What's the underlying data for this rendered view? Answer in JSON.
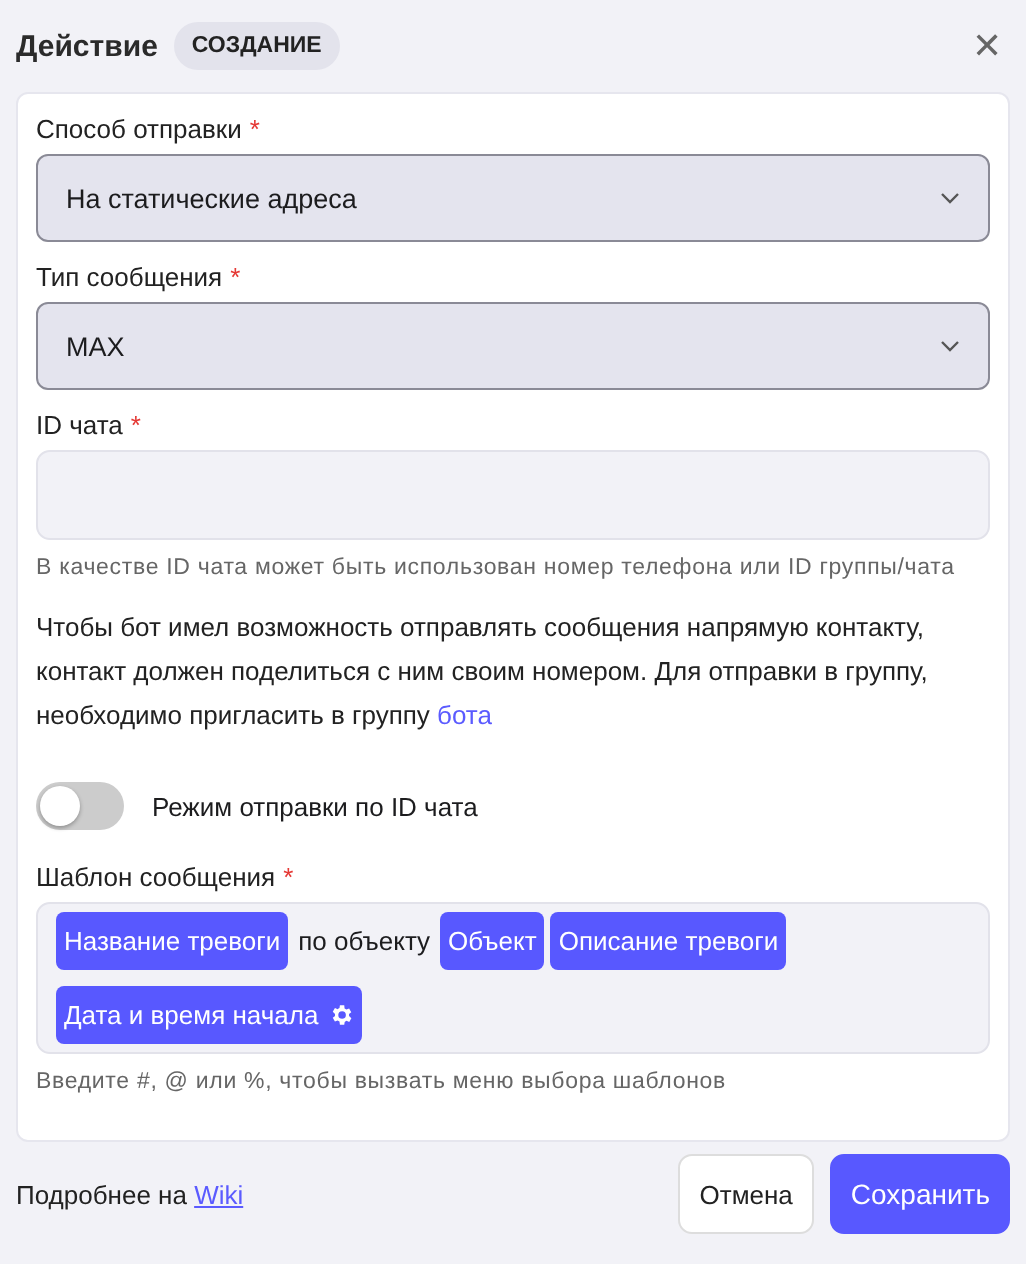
{
  "header": {
    "title": "Действие",
    "badge": "СОЗДАНИЕ",
    "close": "✕"
  },
  "fields": [
    {
      "kind": "select",
      "label": "Способ отправки",
      "required_mark": "*",
      "value": "На статические адреса"
    },
    {
      "kind": "select",
      "label": "Тип сообщения",
      "required_mark": "*",
      "value": "MAX"
    },
    {
      "kind": "input",
      "label": "ID чата",
      "required_mark": "*",
      "hint": "В качестве ID чата может быть использован номер телефона или ID группы/чата"
    }
  ],
  "info": {
    "text": "Чтобы бот имел возможность отправлять сообщения напрямую контакту, контакт должен поделиться с ним своим номером. Для отправки в группу, необходимо пригласить в группу ",
    "link": "бота"
  },
  "toggle": {
    "label": "Режим отправки по ID чата",
    "on": false
  },
  "template": {
    "label": "Шаблон сообщения",
    "required_mark": "*",
    "hint": "Введите #, @ или %, чтобы вызвать меню выбора шаблонов",
    "parts": [
      {
        "kind": "token",
        "text": "Название тревоги",
        "settings": false
      },
      {
        "kind": "text",
        "text": "по объекту"
      },
      {
        "kind": "token",
        "text": "Объект",
        "settings": false
      },
      {
        "kind": "token",
        "text": "Описание тревоги",
        "settings": false
      },
      {
        "kind": "token",
        "text": "Дата и время начала",
        "settings": true
      }
    ]
  },
  "footer": {
    "text": "Подробнее на ",
    "link": "Wiki",
    "buttons": [
      {
        "label": "Отмена",
        "primary": false
      },
      {
        "label": "Сохранить",
        "primary": true
      }
    ]
  }
}
